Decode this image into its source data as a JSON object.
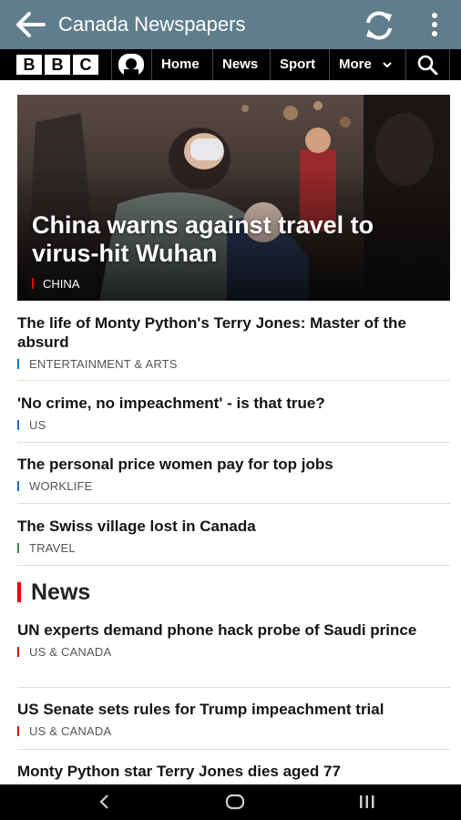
{
  "app": {
    "title": "Canada Newspapers"
  },
  "bbc": {
    "logo_letters": [
      "B",
      "B",
      "C"
    ],
    "nav": [
      "Home",
      "News",
      "Sport",
      "More"
    ]
  },
  "hero": {
    "title": "China warns against travel to virus-hit Wuhan",
    "tag": "CHINA"
  },
  "stories": [
    {
      "title": "The life of Monty Python's Terry Jones: Master of the absurd",
      "tag": "ENTERTAINMENT & ARTS"
    },
    {
      "title": "'No crime, no impeachment' - is that true?",
      "tag": "US"
    },
    {
      "title": "The personal price women pay for top jobs",
      "tag": "WORKLIFE"
    },
    {
      "title": "The Swiss village lost in Canada",
      "tag": "TRAVEL"
    }
  ],
  "section": {
    "title": "News"
  },
  "news": [
    {
      "title": "UN experts demand phone hack probe of Saudi prince",
      "tag": "US & CANADA"
    },
    {
      "title": "US Senate sets rules for Trump impeachment trial",
      "tag": "US & CANADA"
    },
    {
      "title": "Monty Python star Terry Jones dies aged 77"
    }
  ]
}
